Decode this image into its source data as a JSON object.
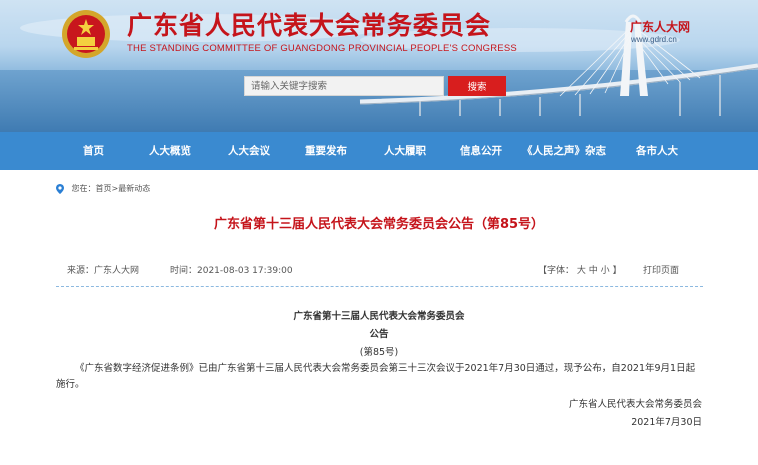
{
  "header": {
    "title": "广东省人民代表大会常务委员会",
    "subtitle": "THE STANDING COMMITTEE OF GUANGDONG PROVINCIAL PEOPLE'S CONGRESS",
    "logo_text": "广东人大网",
    "logo_url": "www.gdrd.cn"
  },
  "search": {
    "placeholder": "请输入关键字搜索",
    "button_label": "搜索"
  },
  "nav": {
    "items": [
      "首页",
      "人大概览",
      "人大会议",
      "重要发布",
      "人大履职",
      "信息公开",
      "《人民之声》杂志",
      "各市人大"
    ]
  },
  "breadcrumb": {
    "prefix": "您在：",
    "home": "首页",
    "separator": ">",
    "current": "最新动态"
  },
  "article": {
    "title": "广东省第十三届人民代表大会常务委员会公告（第85号）",
    "source": "来源：广东人大网",
    "time": "时间：2021-08-03 17:39:00",
    "font_size_label": "【字体：",
    "font_large": "大",
    "font_medium": "中",
    "font_small": "小",
    "font_size_close": "】",
    "print_label": "打印页面",
    "doc_heading": "广东省第十三届人民代表大会常务委员会",
    "doc_type": "公告",
    "doc_number": "(第85号)",
    "body": "《广东省数字经济促进条例》已由广东省第十三届人民代表大会常务委员会第三十三次会议于2021年7月30日通过，现予公布，自2021年9月1日起施行。",
    "signature": "广东省人民代表大会常务委员会",
    "date": "2021年7月30日"
  },
  "colors": {
    "brand_red": "#c5141b",
    "nav_blue": "#3a8ad0",
    "search_red": "#d81e1e"
  }
}
